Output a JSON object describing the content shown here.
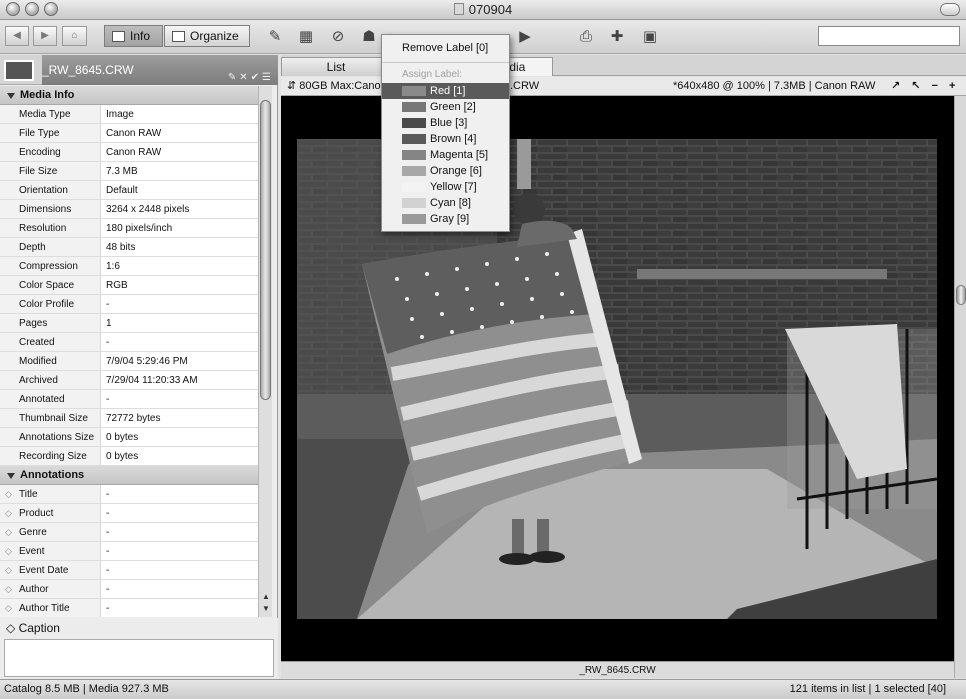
{
  "window": {
    "title": "070904"
  },
  "toolbar": {
    "info_label": "Info",
    "organize_label": "Organize",
    "search_value": ""
  },
  "file": {
    "name": "_RW_8645.CRW"
  },
  "sections": {
    "media_info": "Media Info",
    "annotations": "Annotations"
  },
  "media_info": [
    {
      "k": "Media Type",
      "v": "Image"
    },
    {
      "k": "File Type",
      "v": "Canon RAW"
    },
    {
      "k": "Encoding",
      "v": "Canon RAW"
    },
    {
      "k": "File Size",
      "v": "7.3  MB"
    },
    {
      "k": "Orientation",
      "v": "Default"
    },
    {
      "k": "Dimensions",
      "v": "3264 x 2448 pixels"
    },
    {
      "k": "Resolution",
      "v": "180 pixels/inch"
    },
    {
      "k": "Depth",
      "v": "48 bits"
    },
    {
      "k": "Compression",
      "v": "1:6"
    },
    {
      "k": "Color Space",
      "v": "RGB"
    },
    {
      "k": "Color Profile",
      "v": "-"
    },
    {
      "k": "Pages",
      "v": "1"
    },
    {
      "k": "Created",
      "v": "-"
    },
    {
      "k": "Modified",
      "v": "7/9/04 5:29:46 PM"
    },
    {
      "k": "Archived",
      "v": "7/29/04 11:20:33 AM"
    },
    {
      "k": "Annotated",
      "v": "-"
    },
    {
      "k": "Thumbnail Size",
      "v": "72772 bytes"
    },
    {
      "k": "Annotations Size",
      "v": "0 bytes"
    },
    {
      "k": "Recording Size",
      "v": "0 bytes"
    }
  ],
  "annotations": [
    {
      "k": "Title",
      "v": "-"
    },
    {
      "k": "Product",
      "v": "-"
    },
    {
      "k": "Genre",
      "v": "-"
    },
    {
      "k": "Event",
      "v": "-"
    },
    {
      "k": "Event Date",
      "v": "-"
    },
    {
      "k": "Author",
      "v": "-"
    },
    {
      "k": "Author Title",
      "v": "-"
    }
  ],
  "caption": {
    "label": "Caption",
    "value": ""
  },
  "tabs": {
    "list": "List",
    "media": "Media"
  },
  "infobar": {
    "volume": "80GB Max:Canon",
    "filename": ".CRW",
    "details": "*640x480 @ 100%  |  7.3MB  |  Canon RAW",
    "controls": "↗ ↖ − +"
  },
  "viewer": {
    "caption": "_RW_8645.CRW"
  },
  "status": {
    "left": "Catalog   8.5 MB   |   Media 927.3 MB",
    "right": "121 items in list   |   1 selected [40]"
  },
  "label_menu": {
    "remove": "Remove Label [0]",
    "assign": "Assign Label:",
    "items": [
      {
        "label": "Red [1]",
        "color": "#8a8a8a",
        "selected": true
      },
      {
        "label": "Green [2]",
        "color": "#777777"
      },
      {
        "label": "Blue [3]",
        "color": "#4a4a4a"
      },
      {
        "label": "Brown [4]",
        "color": "#5a5a5a"
      },
      {
        "label": "Magenta [5]",
        "color": "#858585"
      },
      {
        "label": "Orange [6]",
        "color": "#a8a8a8"
      },
      {
        "label": "Yellow [7]",
        "color": "#f3f3f3"
      },
      {
        "label": "Cyan [8]",
        "color": "#d2d2d2"
      },
      {
        "label": "Gray [9]",
        "color": "#9a9a9a"
      }
    ]
  }
}
